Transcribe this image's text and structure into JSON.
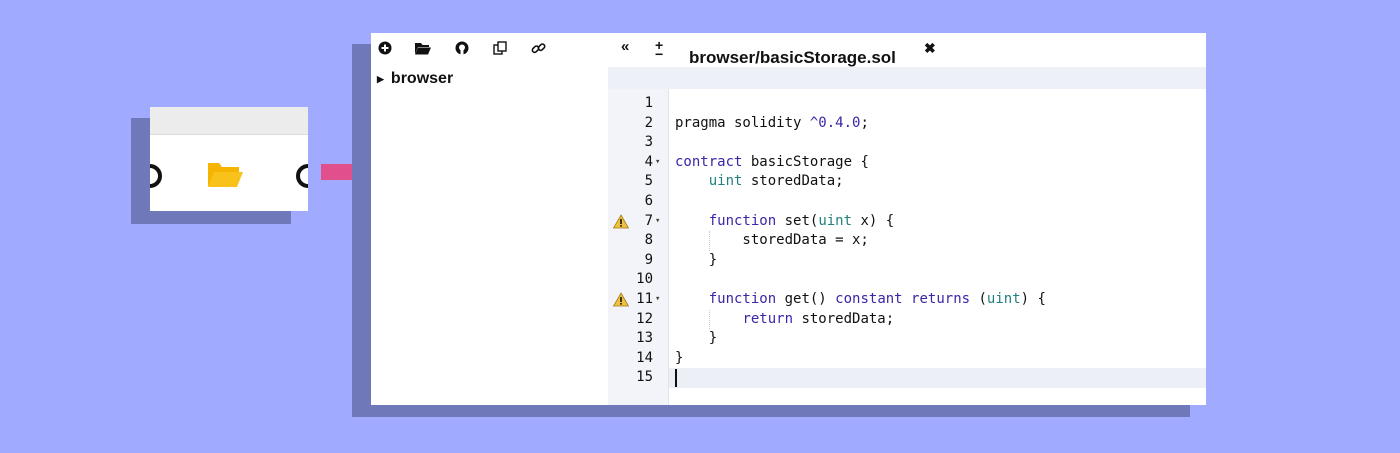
{
  "colors": {
    "background": "#a0aaff",
    "shadow": "#6f78b8",
    "arrow": "#e1508c",
    "folder": "#f5b400",
    "keyword": "#3a26a8",
    "type": "#23807e",
    "warning": "#f0c040"
  },
  "toolbar": {
    "icons": [
      "plus-circle-icon",
      "folder-open-icon",
      "github-icon",
      "copy-icon",
      "link-icon"
    ]
  },
  "file_explorer": {
    "root_label": "browser"
  },
  "editor_panel": {
    "collapse_icon": "double-chevron-left-icon",
    "font_size_icon": "plus-minus-icon"
  },
  "tab": {
    "title": "browser/basicStorage.sol",
    "close_icon": "close-icon"
  },
  "editor": {
    "active_line": 15,
    "lines": [
      {
        "n": "1",
        "code": ""
      },
      {
        "n": "2",
        "code": "pragma solidity ^0.4.0;"
      },
      {
        "n": "3",
        "code": ""
      },
      {
        "n": "4",
        "code": "contract basicStorage {",
        "fold": true
      },
      {
        "n": "5",
        "code": "    uint storedData;"
      },
      {
        "n": "6",
        "code": ""
      },
      {
        "n": "7",
        "code": "    function set(uint x) {",
        "fold": true,
        "warning": true
      },
      {
        "n": "8",
        "code": "        storedData = x;"
      },
      {
        "n": "9",
        "code": "    }"
      },
      {
        "n": "10",
        "code": ""
      },
      {
        "n": "11",
        "code": "    function get() constant returns (uint) {",
        "fold": true,
        "warning": true
      },
      {
        "n": "12",
        "code": "        return storedData;"
      },
      {
        "n": "13",
        "code": "    }"
      },
      {
        "n": "14",
        "code": "}"
      },
      {
        "n": "15",
        "code": ""
      }
    ]
  }
}
